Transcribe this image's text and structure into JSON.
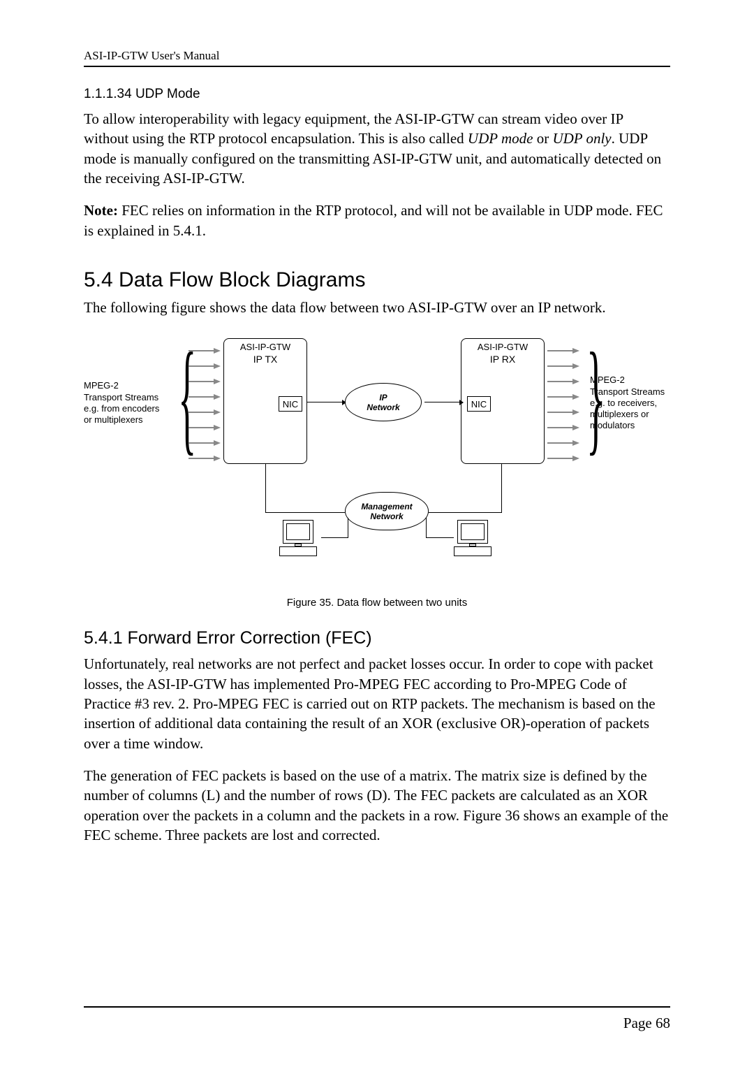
{
  "header": {
    "title": "ASI-IP-GTW User's Manual"
  },
  "section_udp": {
    "heading": "1.1.1.34 UDP Mode",
    "para1_a": "To allow interoperability with legacy equipment, the ASI-IP-GTW can stream video over IP without using the RTP protocol encapsulation. This is also called ",
    "para1_b": "UDP mode",
    "para1_c": " or ",
    "para1_d": "UDP only",
    "para1_e": ". UDP mode is manually configured on the transmitting ASI-IP-GTW unit, and automatically detected on the receiving ASI-IP-GTW.",
    "note_label": "Note:",
    "note_text": " FEC relies on information in the RTP protocol, and will not be available in UDP mode. FEC is explained in 5.4.1."
  },
  "section_flow": {
    "heading": "5.4  Data Flow Block Diagrams",
    "para": "The following figure shows the data flow between two ASI-IP-GTW over an IP network."
  },
  "diagram": {
    "left_label": "MPEG-2\nTransport Streams\ne.g. from encoders\nor multiplexers",
    "right_label": "MPEG-2\nTransport Streams\ne.g. to receivers,\nmultiplexers or\nmodulators",
    "box_tx_top": "ASI-IP-GTW",
    "box_tx_sub": "IP TX",
    "box_rx_top": "ASI-IP-GTW",
    "box_rx_sub": "IP RX",
    "nic": "NIC",
    "ip_net": "IP\nNetwork",
    "mgmt_net": "Management\nNetwork"
  },
  "figure_caption": "Figure 35. Data flow between two units",
  "section_fec": {
    "heading": "5.4.1 Forward Error Correction (FEC)",
    "para1": "Unfortunately, real networks are not perfect and packet losses occur. In order to cope with packet losses, the ASI-IP-GTW has implemented Pro-MPEG FEC according to Pro-MPEG Code of Practice #3 rev. 2. Pro-MPEG FEC is carried out on RTP packets. The mechanism is based on the insertion of additional data containing the result of an XOR (exclusive OR)-operation of packets over a time window.",
    "para2": "The generation of FEC packets is based on the use of a matrix. The matrix size is defined by the number of columns (L) and the number of rows (D). The FEC packets are calculated as an XOR operation over the packets in a column and the packets in a row. Figure 36 shows an example of the FEC scheme. Three packets are lost and corrected."
  },
  "footer": {
    "page": "Page 68"
  }
}
